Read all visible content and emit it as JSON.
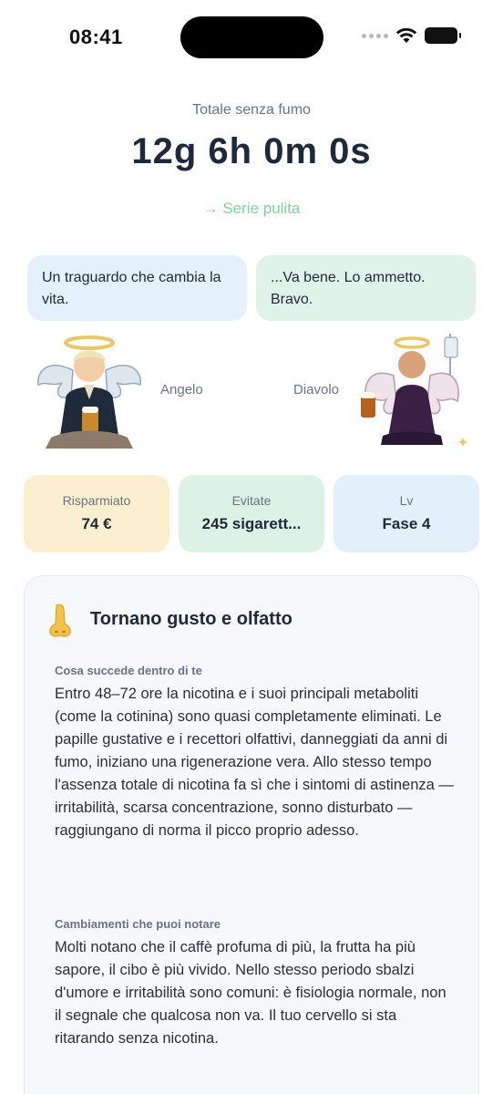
{
  "status_bar": {
    "time": "08:41"
  },
  "header": {
    "total_label": "Totale senza fumo",
    "timer": "12g 6h 0m 0s",
    "streak_link": "→ Serie pulita"
  },
  "characters": {
    "angel": {
      "bubble": "Un traguardo che cambia la vita.",
      "name": "Angelo"
    },
    "devil": {
      "bubble": "...Va bene. Lo ammetto. Bravo.",
      "name": "Diavolo"
    }
  },
  "stats": [
    {
      "label": "Risparmiato",
      "value": "74 €"
    },
    {
      "label": "Evitate",
      "value": "245 sigarett..."
    },
    {
      "label": "Lv",
      "value": "Fase 4"
    }
  ],
  "milestone": {
    "icon": "nose-icon",
    "title": "Tornano gusto e olfatto",
    "sections": [
      {
        "label": "Cosa succede dentro di te",
        "text": "Entro 48–72 ore la nicotina e i suoi principali metaboliti (come la cotinina) sono quasi completamente eliminati. Le papille gustative e i recettori olfattivi, danneggiati da anni di fumo, iniziano una rigenerazione vera. Allo stesso tempo l'assenza totale di nicotina fa sì che i sintomi di astinenza — irritabilità, scarsa concentrazione, sonno disturbato — raggiungano di norma il picco proprio adesso."
      },
      {
        "label": "Cambiamenti che puoi notare",
        "text": "Molti notano che il caffè profuma di più, la frutta ha più sapore, il cibo è più vivido. Nello stesso periodo sbalzi d'umore e irritabilità sono comuni: è fisiologia normale, non il segnale che qualcosa non va. Il tuo cervello si sta ritarando senza nicotina."
      }
    ]
  },
  "colors": {
    "accent_green": "#7fcf9e",
    "angel_bubble": "#e4f0fa",
    "devil_bubble": "#dff3ea",
    "saved_card": "#fbefcf",
    "avoided_card": "#dcf2e6",
    "level_card": "#e3eff9"
  }
}
